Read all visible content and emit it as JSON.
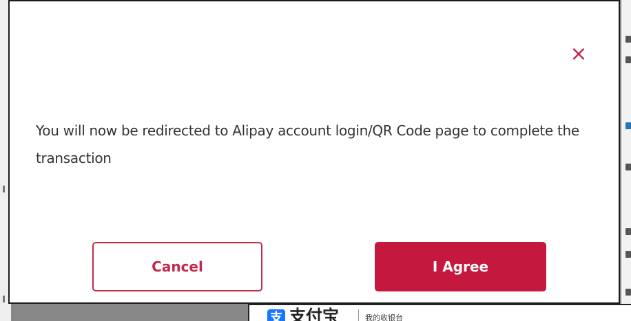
{
  "modal": {
    "close_symbol": "×",
    "message": "You will now be redirected to Alipay account login/QR Code page to complete the transaction",
    "cancel_label": "Cancel",
    "agree_label": "I Agree"
  },
  "alipay": {
    "logo_glyph": "支",
    "brand": "支付宝",
    "subtitle": "我的收银台"
  },
  "colors": {
    "accent": "#c4183f",
    "alipay_blue": "#1677ff"
  }
}
